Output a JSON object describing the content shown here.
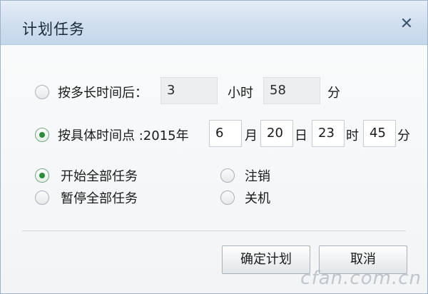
{
  "dialog": {
    "title": "计划任务",
    "close_glyph": "✕"
  },
  "schedule": {
    "after_duration": {
      "label": "按多长时间后：",
      "hours_value": "3",
      "hours_unit": "小时",
      "minutes_value": "58",
      "minutes_unit": "分",
      "selected": false
    },
    "at_time": {
      "label": "按具体时间点 :2015年",
      "month_value": "6",
      "month_unit": "月",
      "day_value": "20",
      "day_unit": "日",
      "hour_value": "23",
      "hour_unit": "时",
      "minute_value": "45",
      "minute_unit": "分",
      "selected": true
    }
  },
  "actions": {
    "start_all": {
      "label": "开始全部任务",
      "selected": true
    },
    "pause_all": {
      "label": "暂停全部任务",
      "selected": false
    },
    "logout": {
      "label": "注销",
      "selected": false
    },
    "shutdown": {
      "label": "关机",
      "selected": false
    }
  },
  "buttons": {
    "confirm_label": "确定计划",
    "cancel_label": "取消"
  },
  "watermark": "cfan.com.cn"
}
